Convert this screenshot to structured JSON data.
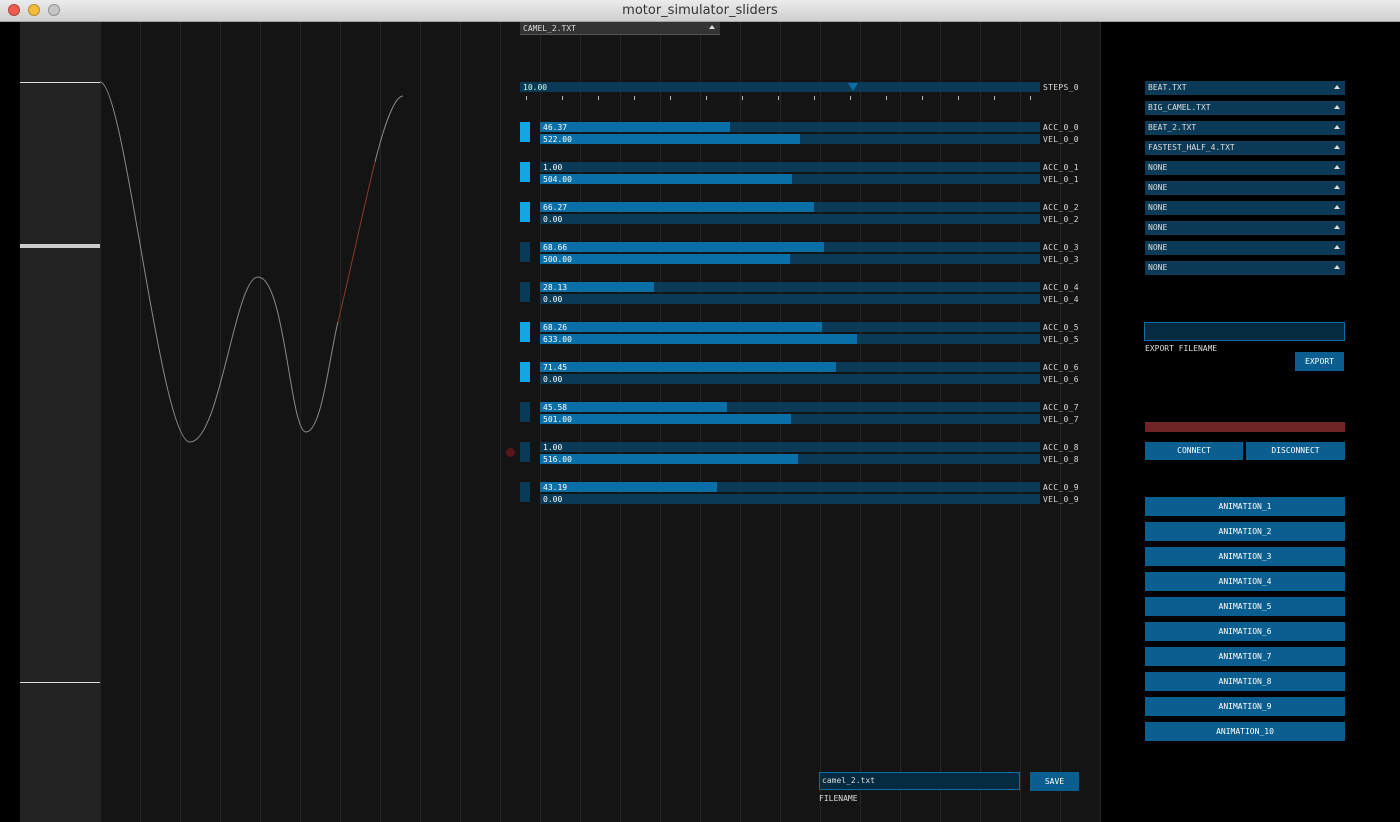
{
  "window": {
    "title": "motor_simulator_sliders"
  },
  "file_dropdown": {
    "selected": "CAMEL_2.TXT"
  },
  "steps": {
    "value": "10.00",
    "label": "STEPS_0"
  },
  "motors": [
    {
      "acc": "46.37",
      "acc_frac": 0.38,
      "acc_label": "ACC_0_0",
      "vel": "522.00",
      "vel_frac": 0.52,
      "vel_label": "VEL_0_0",
      "active": true
    },
    {
      "acc": "1.00",
      "acc_frac": 0.0,
      "acc_label": "ACC_0_1",
      "vel": "504.00",
      "vel_frac": 0.504,
      "vel_label": "VEL_0_1",
      "active": true
    },
    {
      "acc": "66.27",
      "acc_frac": 0.548,
      "acc_label": "ACC_0_2",
      "vel": "0.00",
      "vel_frac": 0.0,
      "vel_label": "VEL_0_2",
      "active": true
    },
    {
      "acc": "68.66",
      "acc_frac": 0.568,
      "acc_label": "ACC_0_3",
      "vel": "500.00",
      "vel_frac": 0.5,
      "vel_label": "VEL_0_3",
      "active": false
    },
    {
      "acc": "28.13",
      "acc_frac": 0.228,
      "acc_label": "ACC_0_4",
      "vel": "0.00",
      "vel_frac": 0.0,
      "vel_label": "VEL_0_4",
      "active": false
    },
    {
      "acc": "68.26",
      "acc_frac": 0.564,
      "acc_label": "ACC_0_5",
      "vel": "633.00",
      "vel_frac": 0.633,
      "vel_label": "VEL_0_5",
      "active": true
    },
    {
      "acc": "71.45",
      "acc_frac": 0.592,
      "acc_label": "ACC_0_6",
      "vel": "0.00",
      "vel_frac": 0.0,
      "vel_label": "VEL_0_6",
      "active": true
    },
    {
      "acc": "45.58",
      "acc_frac": 0.374,
      "acc_label": "ACC_0_7",
      "vel": "501.00",
      "vel_frac": 0.501,
      "vel_label": "VEL_0_7",
      "active": false
    },
    {
      "acc": "1.00",
      "acc_frac": 0.0,
      "acc_label": "ACC_0_8",
      "vel": "516.00",
      "vel_frac": 0.516,
      "vel_label": "VEL_0_8",
      "active": false
    },
    {
      "acc": "43.19",
      "acc_frac": 0.354,
      "acc_label": "ACC_0_9",
      "vel": "0.00",
      "vel_frac": 0.0,
      "vel_label": "VEL_0_9",
      "active": false
    }
  ],
  "save": {
    "filename_value": "camel_2.txt",
    "filename_label": "FILENAME",
    "save_label": "SAVE"
  },
  "file_slots": [
    "BEAT.TXT",
    "BIG_CAMEL.TXT",
    "BEAT_2.TXT",
    "FASTEST_HALF_4.TXT",
    "NONE",
    "NONE",
    "NONE",
    "NONE",
    "NONE",
    "NONE"
  ],
  "export": {
    "filename_value": "",
    "label": "EXPORT FILENAME",
    "button": "EXPORT"
  },
  "connection": {
    "status_color": "#6f2525",
    "connect": "CONNECT",
    "disconnect": "DISCONNECT"
  },
  "animations": [
    "ANIMATION_1",
    "ANIMATION_2",
    "ANIMATION_3",
    "ANIMATION_4",
    "ANIMATION_5",
    "ANIMATION_6",
    "ANIMATION_7",
    "ANIMATION_8",
    "ANIMATION_9",
    "ANIMATION_10"
  ],
  "colors": {
    "accent": "#0a6fa6",
    "slider_bg": "#0b3a56",
    "indicator_on": "#12a6e6",
    "button": "#0a5e90",
    "curve": "#8a8a8a",
    "curve_highlight": "#8a3a2a"
  }
}
